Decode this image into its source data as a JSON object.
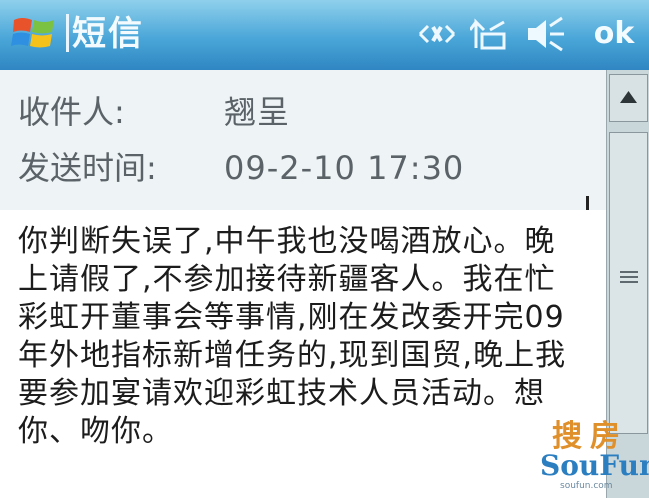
{
  "titlebar": {
    "title": "短信",
    "ok_label": "ok",
    "icons": [
      "windows-start-logo",
      "connectivity-icon",
      "signal-icon",
      "volume-icon"
    ]
  },
  "header": {
    "recipient_label": "收件人:",
    "recipient_value": "翘呈",
    "sent_time_label": "发送时间:",
    "sent_time_value": "09-2-10 17:30"
  },
  "message": {
    "lines": [
      "你判断失误了,中午我也没喝酒放心。晚",
      "上请假了,不参加接待新疆客人。我在忙",
      "彩虹开董事会等事情,刚在发改委开完09",
      "年外地指标新增任务的,现到国贸,晚上我",
      "要参加宴请欢迎彩虹技术人员活动。想",
      "你、吻你。"
    ]
  },
  "watermark": {
    "top": "搜房",
    "bottom": "SouFun",
    "url": "soufun.com"
  },
  "colors": {
    "titlebar": "#3f9bd2",
    "body_bg": "#ffffff",
    "header_bg": "#eef3f5",
    "text": "#1c1c1c"
  }
}
